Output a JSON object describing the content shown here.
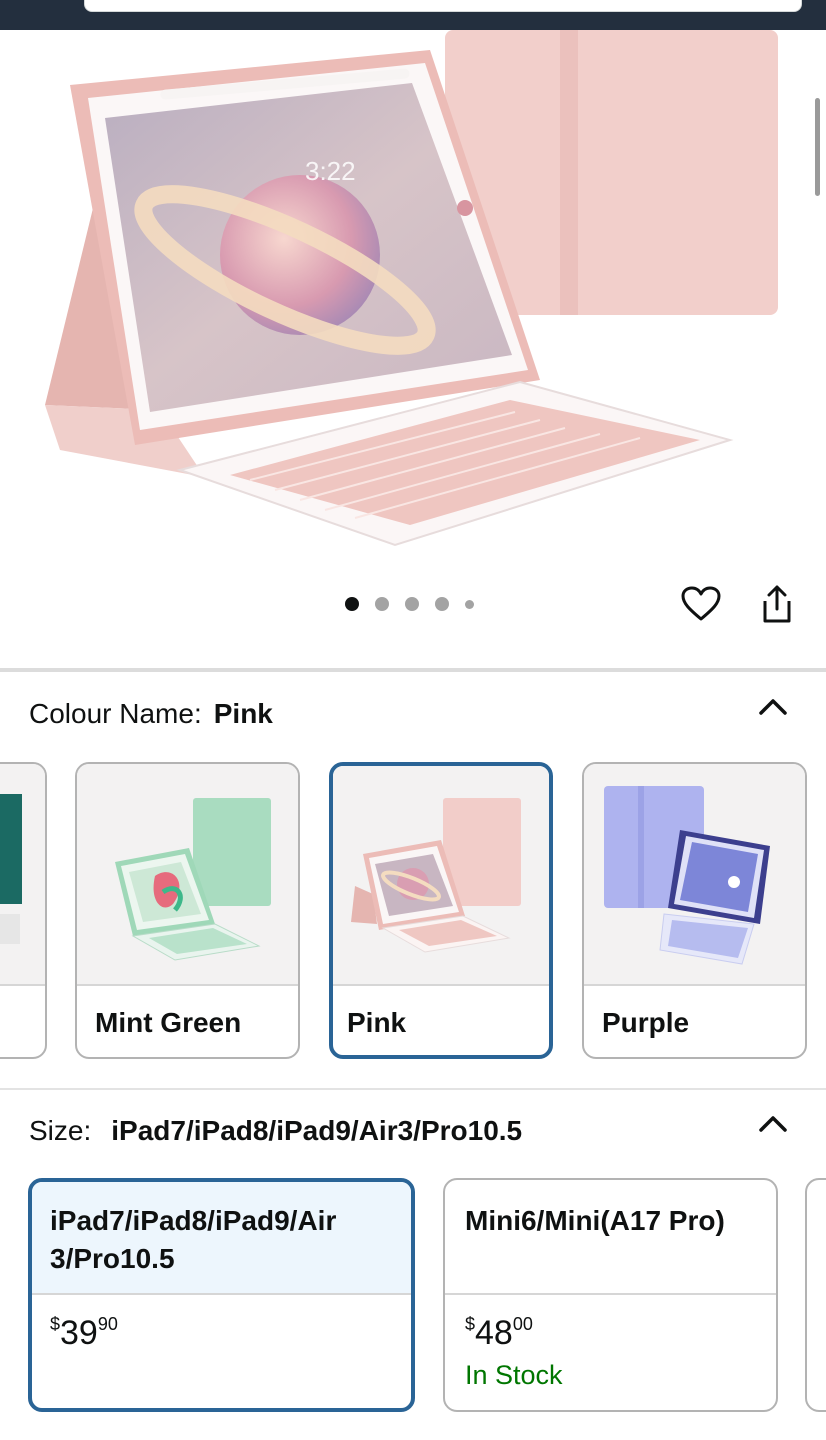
{
  "colours": {
    "label": "Colour Name:",
    "selected_value": "Pink",
    "options": [
      {
        "name": ""
      },
      {
        "name": "Mint Green"
      },
      {
        "name": "Pink"
      },
      {
        "name": "Purple"
      }
    ]
  },
  "sizes": {
    "label": "Size:",
    "selected_value": "iPad7/iPad8/iPad9/Air3/Pro10.5",
    "options": [
      {
        "name": "iPad7/iPad8/iPad9/Air 3/Pro10.5",
        "currency": "$",
        "price_whole": "39",
        "price_fraction": "90",
        "stock": ""
      },
      {
        "name": "Mini6/Mini(A17 Pro)",
        "currency": "$",
        "price_whole": "48",
        "price_fraction": "00",
        "stock": "In Stock"
      }
    ]
  },
  "gallery": {
    "image_count": 5,
    "current_index": 1
  },
  "icons": {
    "favorite": "heart-icon",
    "share": "share-icon",
    "collapse": "chevron-up-icon"
  },
  "colors": {
    "selected_border": "#2a6496",
    "in_stock": "#007600",
    "header": "#232f3e"
  }
}
